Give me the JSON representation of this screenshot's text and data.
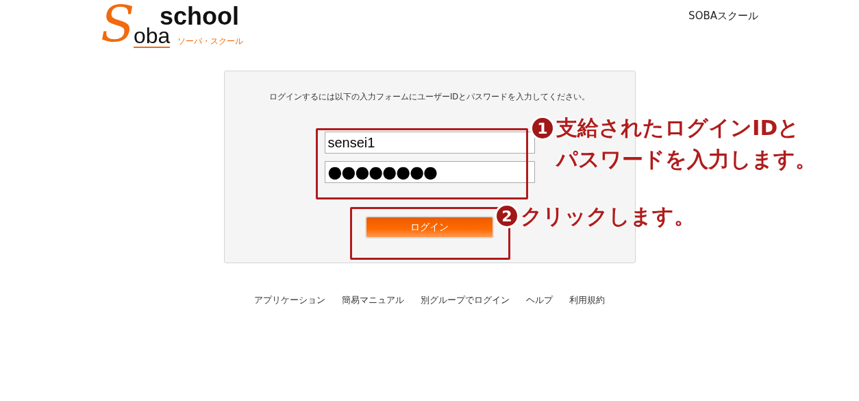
{
  "header": {
    "logo": {
      "letter": "S",
      "word": "oba",
      "school": "school",
      "kana": "ソーバ・スクール"
    },
    "site_name": "SOBAスクール"
  },
  "login": {
    "instructions": "ログインするには以下の入力フォームにユーザーIDとパスワードを入力してください。",
    "user_id": {
      "value": "sensei1"
    },
    "password": {
      "value": "●●●●●●●●"
    },
    "button": "ログイン"
  },
  "annotations": [
    {
      "number": "1",
      "lines": [
        "支給されたログインIDと",
        "パスワードを入力します。"
      ]
    },
    {
      "number": "2",
      "lines": [
        "クリックします。"
      ]
    }
  ],
  "footer_links": [
    "アプリケーション",
    "簡易マニュアル",
    "別グループでログイン",
    "ヘルプ",
    "利用規約"
  ]
}
